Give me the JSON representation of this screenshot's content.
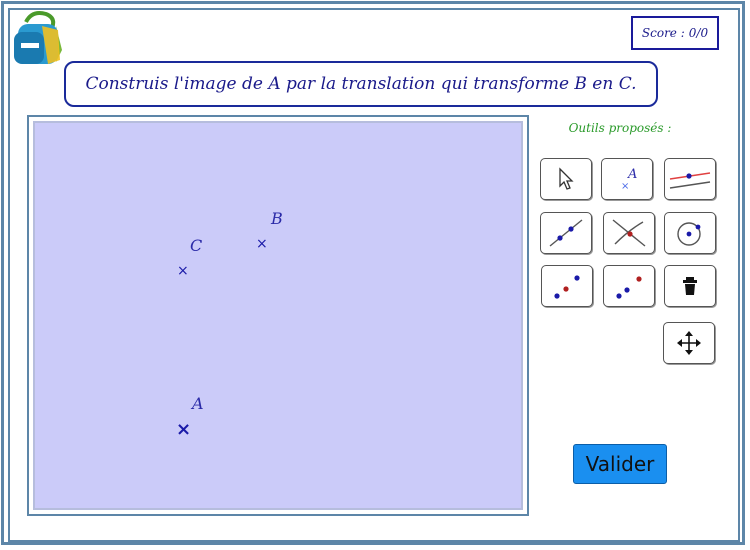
{
  "score": {
    "label": "Score :",
    "value": "0/0"
  },
  "instruction": "Construis l'image de A par la translation qui transforme B en C.",
  "canvas": {
    "points": [
      {
        "label": "B"
      },
      {
        "label": "C"
      },
      {
        "label": "A"
      }
    ]
  },
  "tools": {
    "title": "Outils proposés :",
    "items": [
      {
        "icon": "move-pointer-icon"
      },
      {
        "icon": "point-icon",
        "glyph": "A"
      },
      {
        "icon": "parallel-lines-icon"
      },
      {
        "icon": "line-through-two-points-icon"
      },
      {
        "icon": "intersection-icon"
      },
      {
        "icon": "circle-center-point-icon"
      },
      {
        "icon": "vector-icon"
      },
      {
        "icon": "translation-icon"
      },
      {
        "icon": "trash-icon"
      },
      {
        "icon": "move-graphics-icon"
      }
    ]
  },
  "validate_label": "Valider",
  "colors": {
    "canvas": "#cbcbf9",
    "point": "#1a1aa8",
    "tools_title": "#2a9a2a",
    "button": "#1a8ff0",
    "frame": "#5d86a8"
  }
}
